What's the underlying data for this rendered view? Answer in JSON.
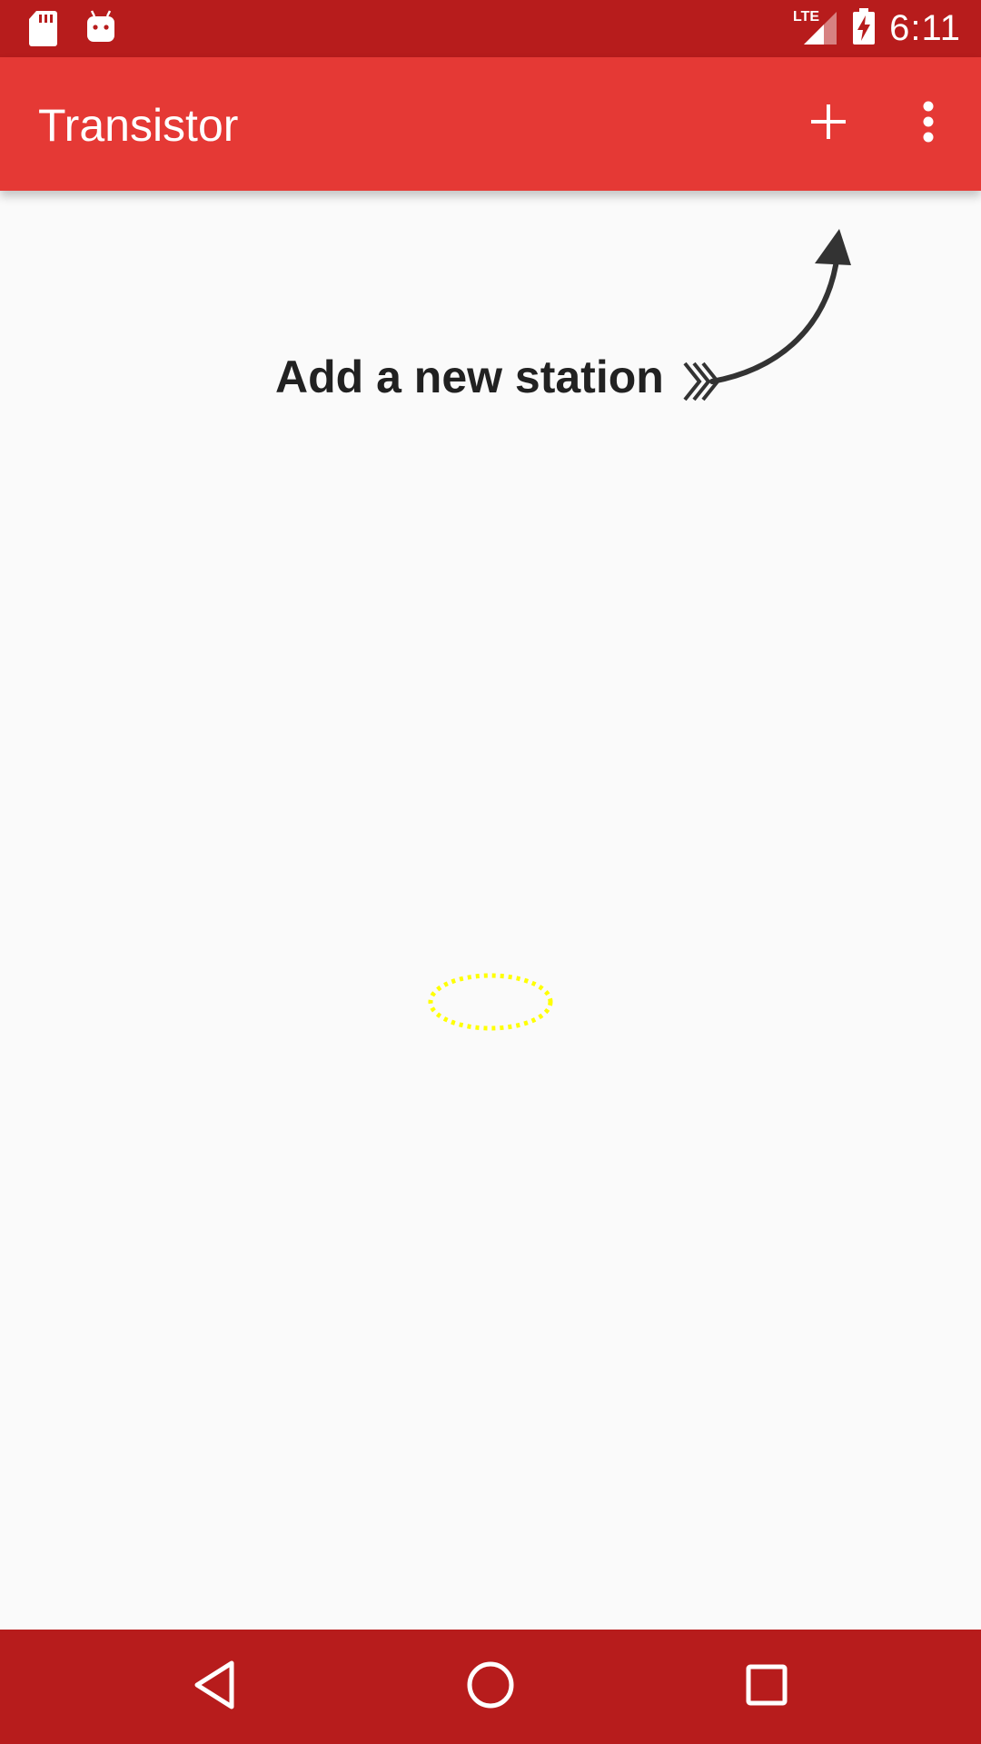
{
  "status_bar": {
    "time": "6:11",
    "network_label": "LTE",
    "left_icons": [
      "sd-card-icon",
      "android-icon"
    ],
    "right_icons": [
      "lte-signal-icon",
      "battery-charging-icon"
    ],
    "color": "#b71c1c"
  },
  "app_bar": {
    "title": "Transistor",
    "actions": [
      {
        "name": "add-station-button",
        "icon": "plus-icon"
      },
      {
        "name": "overflow-menu-button",
        "icon": "more-vert-icon"
      }
    ],
    "color": "#e53935"
  },
  "onboarding": {
    "hint": "Add a new station",
    "arrow_icon": "curved-arrow-icon"
  },
  "content": {
    "indicator_icon": "dotted-ring-icon",
    "indicator_color": "#ffff00"
  },
  "nav_bar": {
    "buttons": [
      "back-icon",
      "home-icon",
      "recents-icon"
    ],
    "color": "#b71c1c"
  },
  "colors": {
    "background": "#fafafa",
    "text_dark": "#212121",
    "white": "#ffffff"
  }
}
